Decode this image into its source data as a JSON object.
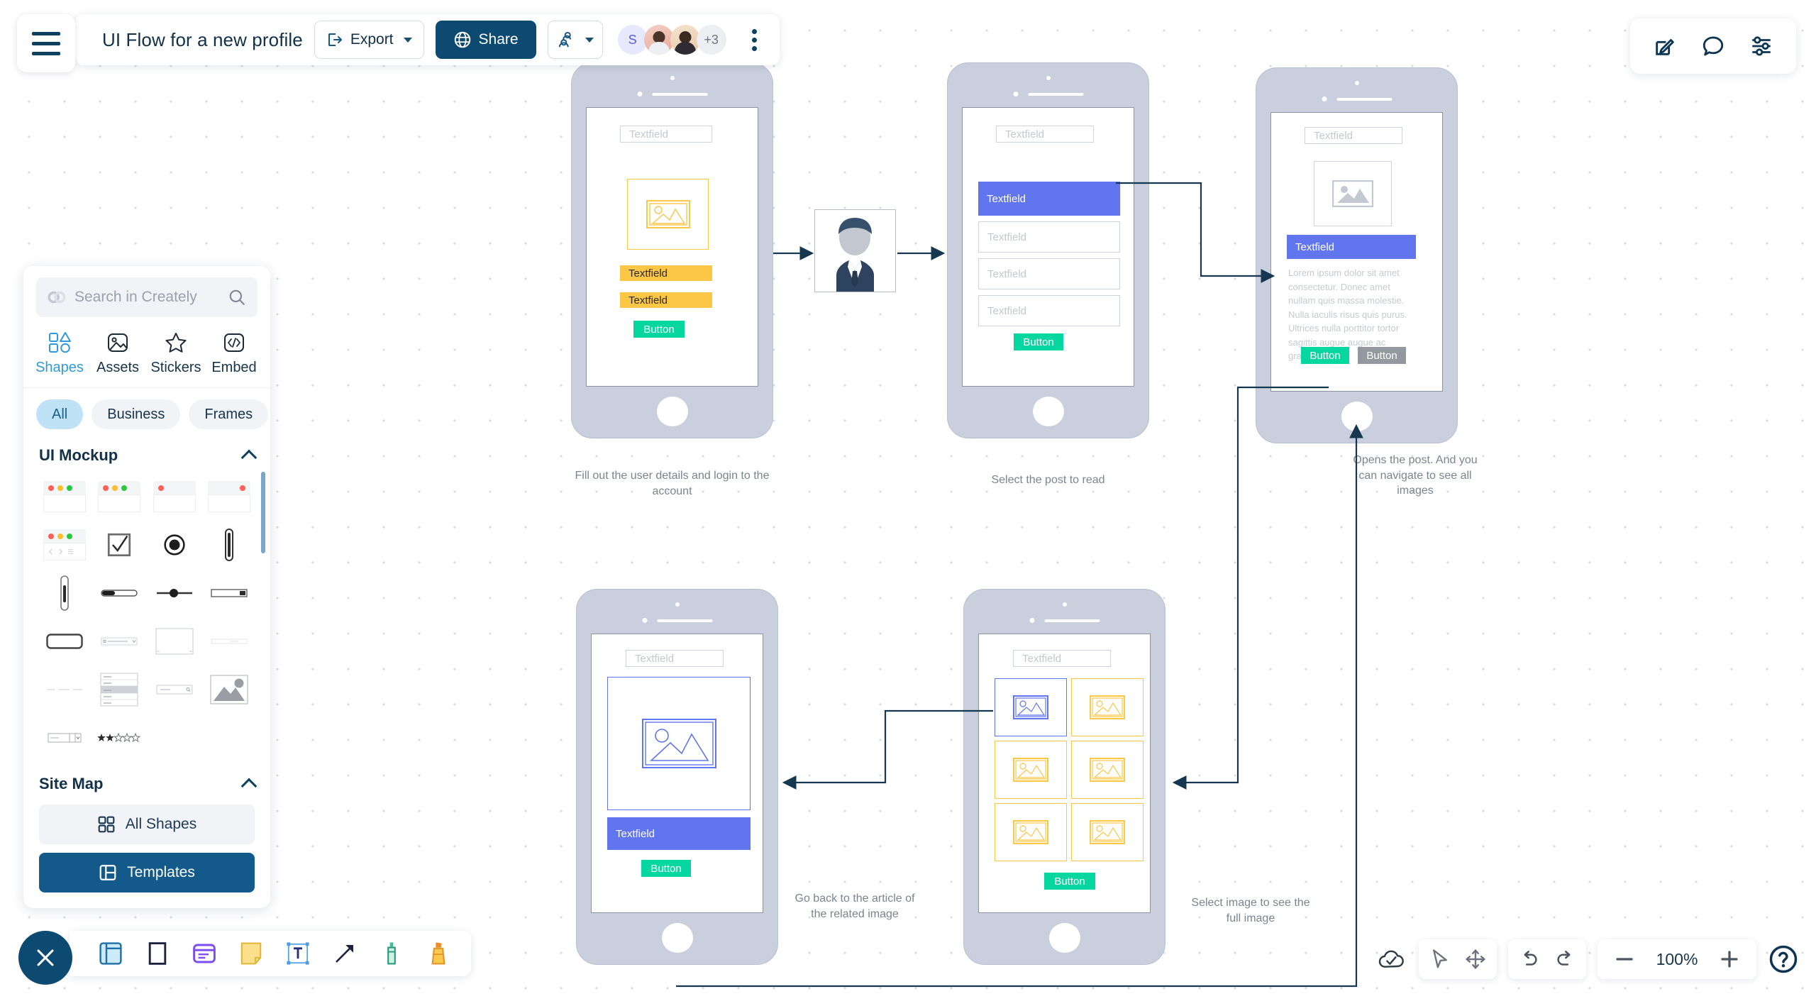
{
  "app": {
    "title": "UI Flow for a new profile",
    "zoom": "100%"
  },
  "toolbar": {
    "export_label": "Export",
    "share_label": "Share",
    "avatar_initial": "S",
    "avatar_overflow": "+3"
  },
  "panel": {
    "search_placeholder": "Search in Creately",
    "categories": [
      {
        "label": "Shapes",
        "icon": "shapes-icon",
        "active": true
      },
      {
        "label": "Assets",
        "icon": "assets-icon",
        "active": false
      },
      {
        "label": "Stickers",
        "icon": "star-icon",
        "active": false
      },
      {
        "label": "Embed",
        "icon": "code-icon",
        "active": false
      }
    ],
    "filters": [
      {
        "label": "All",
        "selected": true
      },
      {
        "label": "Business",
        "selected": false
      },
      {
        "label": "Frames",
        "selected": false
      }
    ],
    "groups": [
      {
        "title": "UI Mockup",
        "expanded": true
      },
      {
        "title": "Site Map",
        "expanded": true
      }
    ],
    "all_shapes_label": "All Shapes",
    "templates_label": "Templates"
  },
  "shape_items": [
    "window-3dots-icon",
    "window-3dots-alt-icon",
    "window-1dot-left-icon",
    "window-1dot-right-icon",
    "browser-nav-icon",
    "checkbox-checked-icon",
    "radio-selected-icon",
    "scrollbar-vertical-icon",
    "scrollbar-vertical-thin-icon",
    "progressbar-icon",
    "slider-icon",
    "scrollbar-horizontal-icon",
    "rounded-rect-icon",
    "search-bar-icon",
    "panel-rect-icon",
    "divider-line-icon",
    "dashed-line-icon",
    "list-menu-icon",
    "search-field-icon",
    "image-placeholder-icon",
    "dropdown-stepper-icon",
    "star-rating-icon"
  ],
  "bottom_tools": [
    "frame-icon",
    "rectangle-icon",
    "card-icon",
    "sticky-note-icon",
    "text-icon",
    "arrow-icon",
    "pen-icon",
    "highlighter-icon"
  ],
  "top_right_tools": [
    "edit-icon",
    "comment-icon",
    "settings-sliders-icon"
  ],
  "bottom_right": {
    "cloud_icon": "cloud-saved-icon",
    "select_icon": "cursor-select-icon",
    "pan_icon": "pan-move-icon",
    "undo_icon": "undo-icon",
    "redo_icon": "redo-icon",
    "zoom_out_icon": "zoom-out-icon",
    "zoom_in_icon": "zoom-in-icon",
    "help_icon": "help-icon"
  },
  "flow": {
    "screens": [
      {
        "id": "login",
        "caption": "Fill out the user details and login to the account",
        "fields": [
          {
            "label": "Textfield",
            "style": "outline"
          },
          {
            "label": "Textfield",
            "style": "yellow"
          },
          {
            "label": "Textfield",
            "style": "yellow"
          }
        ],
        "buttons": [
          {
            "label": "Button",
            "style": "green"
          }
        ],
        "image_placeholder": "image-placeholder-yellow"
      },
      {
        "id": "post-list",
        "caption": "Select the post to read",
        "fields": [
          {
            "label": "Textfield",
            "style": "outline"
          },
          {
            "label": "Textfield",
            "style": "blue"
          },
          {
            "label": "Textfield",
            "style": "outline"
          },
          {
            "label": "Textfield",
            "style": "outline"
          },
          {
            "label": "Textfield",
            "style": "outline"
          }
        ],
        "buttons": [
          {
            "label": "Button",
            "style": "green"
          }
        ]
      },
      {
        "id": "post-detail",
        "caption": "Opens the post. And you can navigate to see all images",
        "fields": [
          {
            "label": "Textfield",
            "style": "outline"
          },
          {
            "label": "Textfield",
            "style": "blue"
          }
        ],
        "body_text": "Lorem ipsum dolor sit amet consectetur. Donec amet nullam quis massa molestie. Nulla iaculis risus quis purus. Ultrices nulla porttitor tortor sagittis augue augue ac gravida.",
        "buttons": [
          {
            "label": "Button",
            "style": "green"
          },
          {
            "label": "Button",
            "style": "grey"
          }
        ],
        "image_placeholder": "image-placeholder-grey"
      },
      {
        "id": "full-image",
        "caption": "Go back to the article of the related image",
        "fields": [
          {
            "label": "Textfield",
            "style": "outline"
          },
          {
            "label": "Textfield",
            "style": "blue"
          }
        ],
        "buttons": [
          {
            "label": "Button",
            "style": "green"
          }
        ],
        "image_placeholder": "image-placeholder-blue"
      },
      {
        "id": "gallery",
        "caption": "Select image to see the full image",
        "fields": [
          {
            "label": "Textfield",
            "style": "outline"
          }
        ],
        "thumbnails": [
          "image-thumb-selected",
          "image-thumb",
          "image-thumb",
          "image-thumb",
          "image-thumb",
          "image-thumb"
        ],
        "buttons": [
          {
            "label": "Button",
            "style": "green"
          }
        ]
      }
    ],
    "actor": "person-avatar"
  },
  "colors": {
    "brand_dark": "#0d4a72",
    "accent_green": "#06d6a0",
    "accent_yellow": "#fcc647",
    "accent_blue": "#6175ef",
    "edge": "#15374f"
  }
}
